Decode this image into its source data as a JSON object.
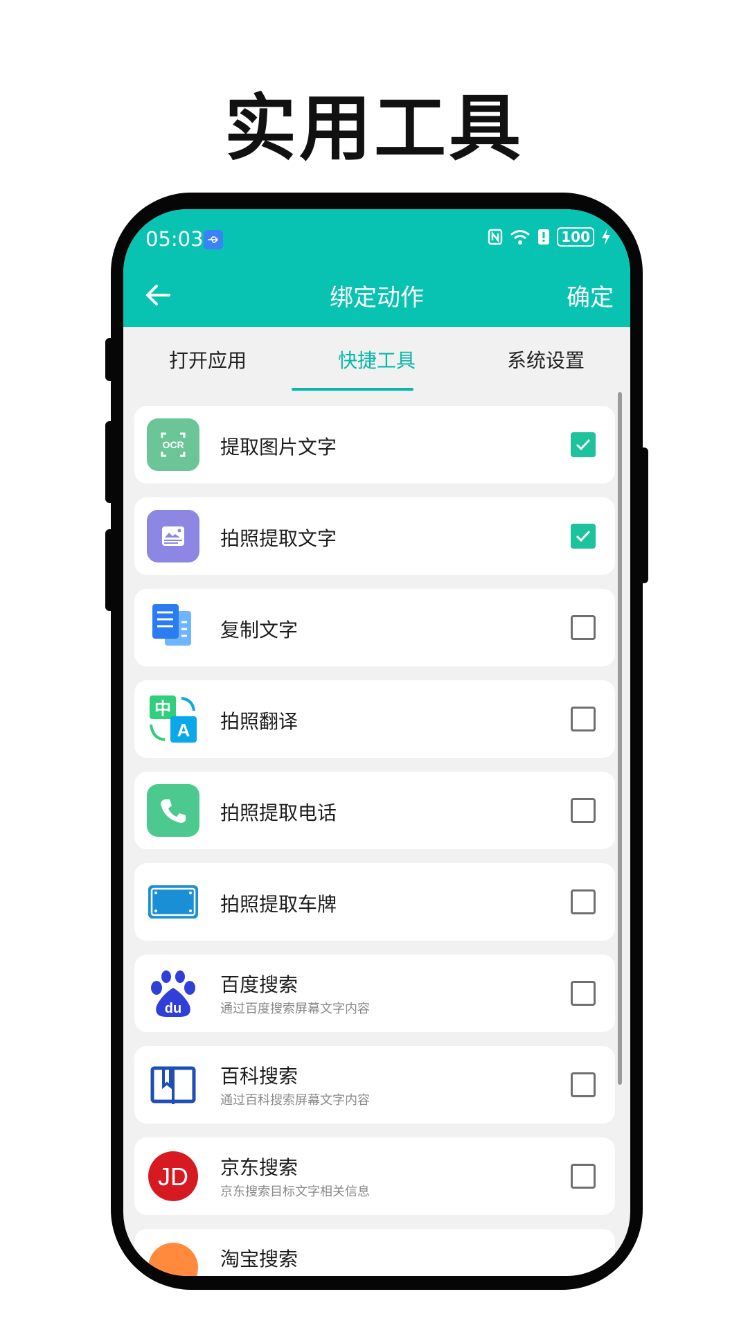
{
  "promo": {
    "title": "实用工具"
  },
  "status_bar": {
    "time": "05:03",
    "battery": "100"
  },
  "app_bar": {
    "title": "绑定动作",
    "confirm_label": "确定"
  },
  "tabs": [
    {
      "label": "打开应用",
      "active": false
    },
    {
      "label": "快捷工具",
      "active": true
    },
    {
      "label": "系统设置",
      "active": false
    }
  ],
  "items": [
    {
      "label": "提取图片文字",
      "checked": true,
      "icon": "ocr-icon"
    },
    {
      "label": "拍照提取文字",
      "checked": true,
      "icon": "photo-text-icon"
    },
    {
      "label": "复制文字",
      "checked": false,
      "icon": "copy-text-icon"
    },
    {
      "label": "拍照翻译",
      "checked": false,
      "icon": "translate-icon",
      "icon_text_1": "中",
      "icon_text_2": "A"
    },
    {
      "label": "拍照提取电话",
      "checked": false,
      "icon": "phone-icon"
    },
    {
      "label": "拍照提取车牌",
      "checked": false,
      "icon": "license-plate-icon"
    },
    {
      "label": "百度搜索",
      "subtitle": "通过百度搜索屏幕文字内容",
      "checked": false,
      "icon": "baidu-icon"
    },
    {
      "label": "百科搜索",
      "subtitle": "通过百科搜索屏幕文字内容",
      "checked": false,
      "icon": "book-icon"
    },
    {
      "label": "京东搜索",
      "subtitle": "京东搜索目标文字相关信息",
      "checked": false,
      "icon": "jd-icon",
      "icon_text_1": "JD"
    },
    {
      "label": "淘宝搜索",
      "checked": false,
      "icon": "taobao-icon"
    }
  ],
  "colors": {
    "accent": "#08c3b1",
    "check": "#1cc39c"
  }
}
